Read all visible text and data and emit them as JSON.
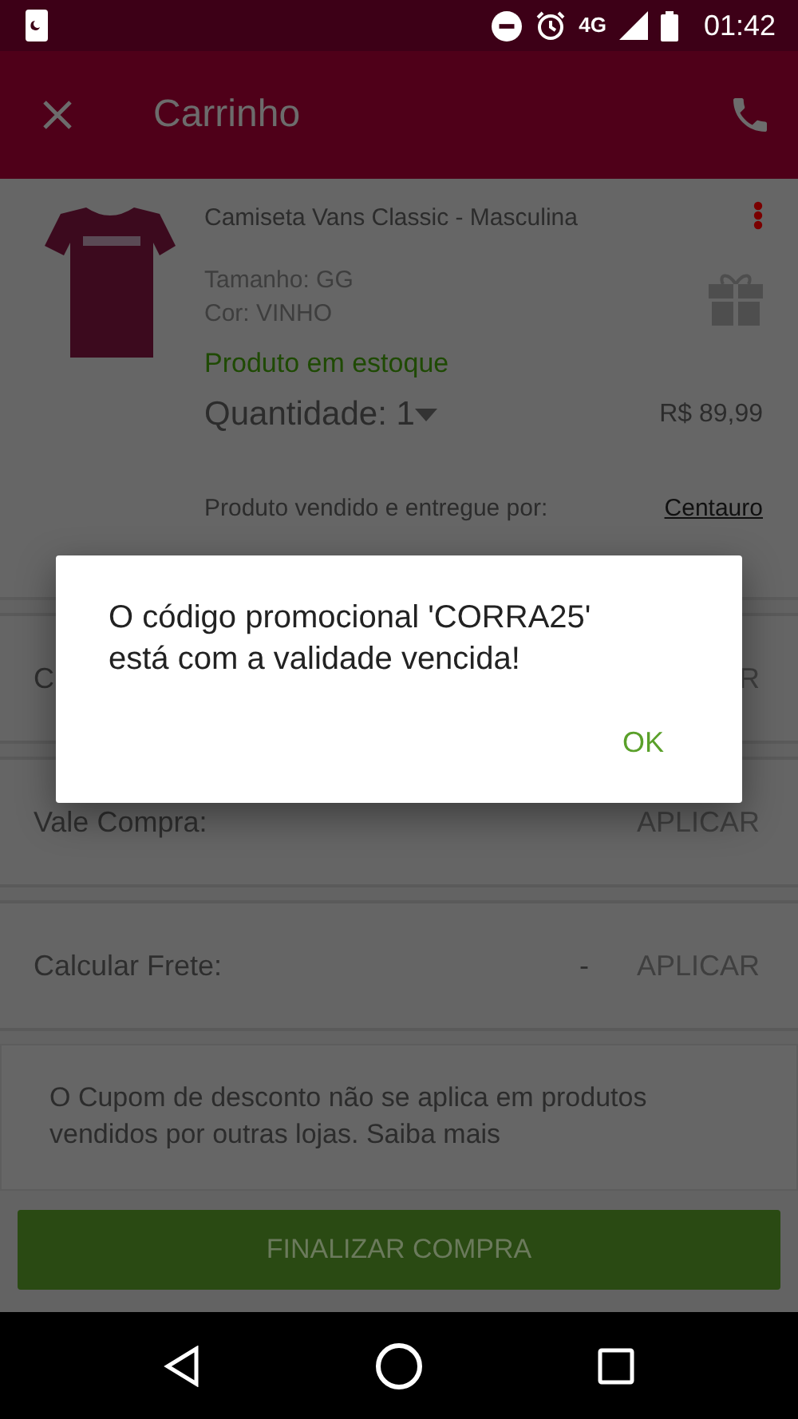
{
  "status_bar": {
    "network": "4G",
    "time": "01:42"
  },
  "app_bar": {
    "title": "Carrinho"
  },
  "product": {
    "name": "Camiseta Vans Classic - Masculina",
    "size": "Tamanho: GG",
    "variant": "Cor: VINHO",
    "stock": "Produto em estoque",
    "quantity": "Quantidade: 1",
    "price": "R$ 89,99",
    "seller_label": "Produto vendido e entregue por:",
    "seller": "Centauro"
  },
  "rows": [
    {
      "label": "C",
      "action": "R"
    },
    {
      "label": "Vale Compra:",
      "action": "APLICAR"
    },
    {
      "label": "Calcular Frete:",
      "value": "-",
      "action": "APLICAR"
    }
  ],
  "notice": {
    "text": "O Cupom de desconto não se aplica em produtos vendidos por outras lojas.",
    "link": "Saiba mais"
  },
  "checkout_button": "FINALIZAR COMPRA",
  "dialog": {
    "message": "O código promocional 'CORRA25' está com a validade vencida!",
    "button": "OK"
  }
}
